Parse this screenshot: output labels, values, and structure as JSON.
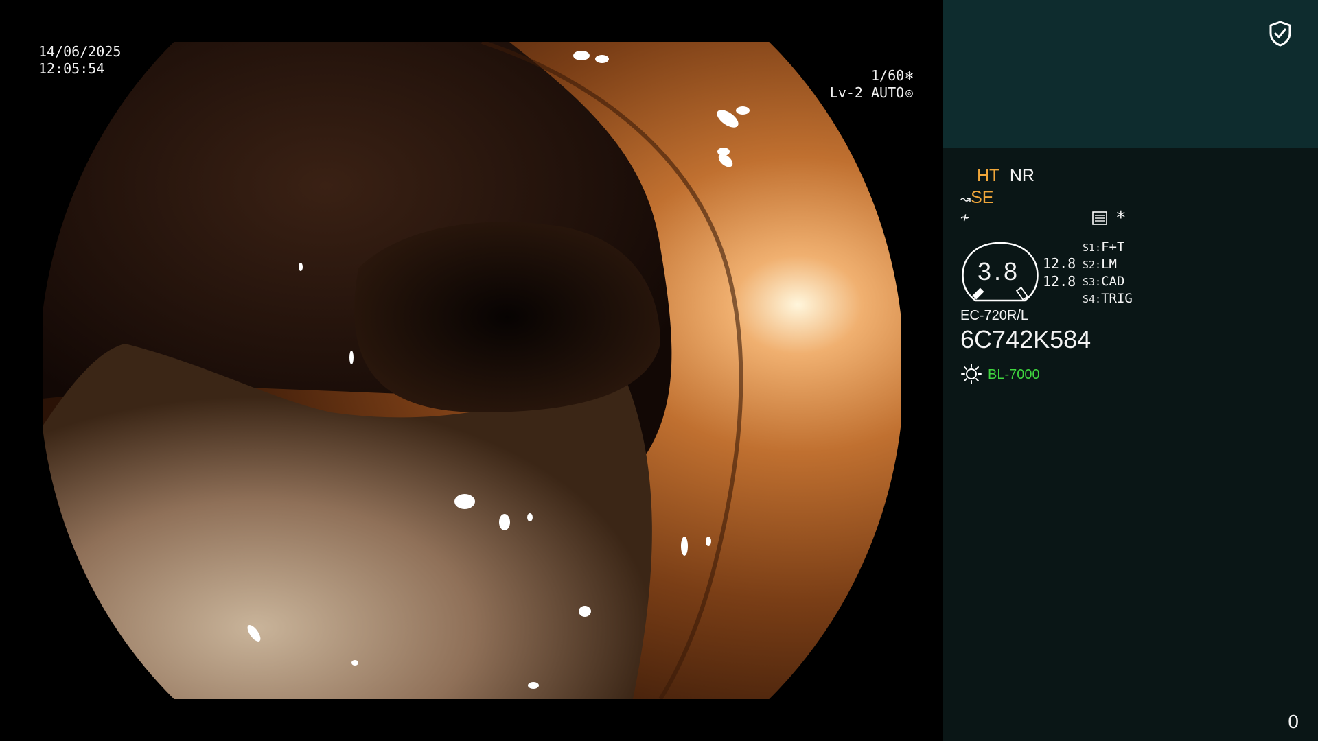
{
  "screen": {
    "date": "14/06/2025",
    "time": "12:05:54",
    "shutter": "1/60",
    "shutter_icon": "aperture-icon",
    "iris": "Lv-2 AUTO",
    "iris_icon": "iris-icon"
  },
  "panel": {
    "security_icon": "shield-check-icon",
    "ht_label": "HT",
    "nr_label": "NR",
    "se_label": "SE",
    "fn_glyph": "≁",
    "asterisk": "*",
    "gauge_value": "3.8",
    "rate_top": "12.8",
    "rate_bottom": "12.8",
    "slots": [
      {
        "key": "S1:",
        "value": "F+T"
      },
      {
        "key": "S2:",
        "value": "LM"
      },
      {
        "key": "S3:",
        "value": "CAD"
      },
      {
        "key": "S4:",
        "value": "TRIG"
      }
    ],
    "model": "EC-720R/L",
    "serial": "6C742K584",
    "light_source": "BL-7000",
    "counter": "0"
  },
  "colors": {
    "accent_orange": "#f0a63a",
    "light_green": "#3fd63f",
    "panel_top": "#0e2c2e",
    "panel_bg": "#0a1616"
  }
}
